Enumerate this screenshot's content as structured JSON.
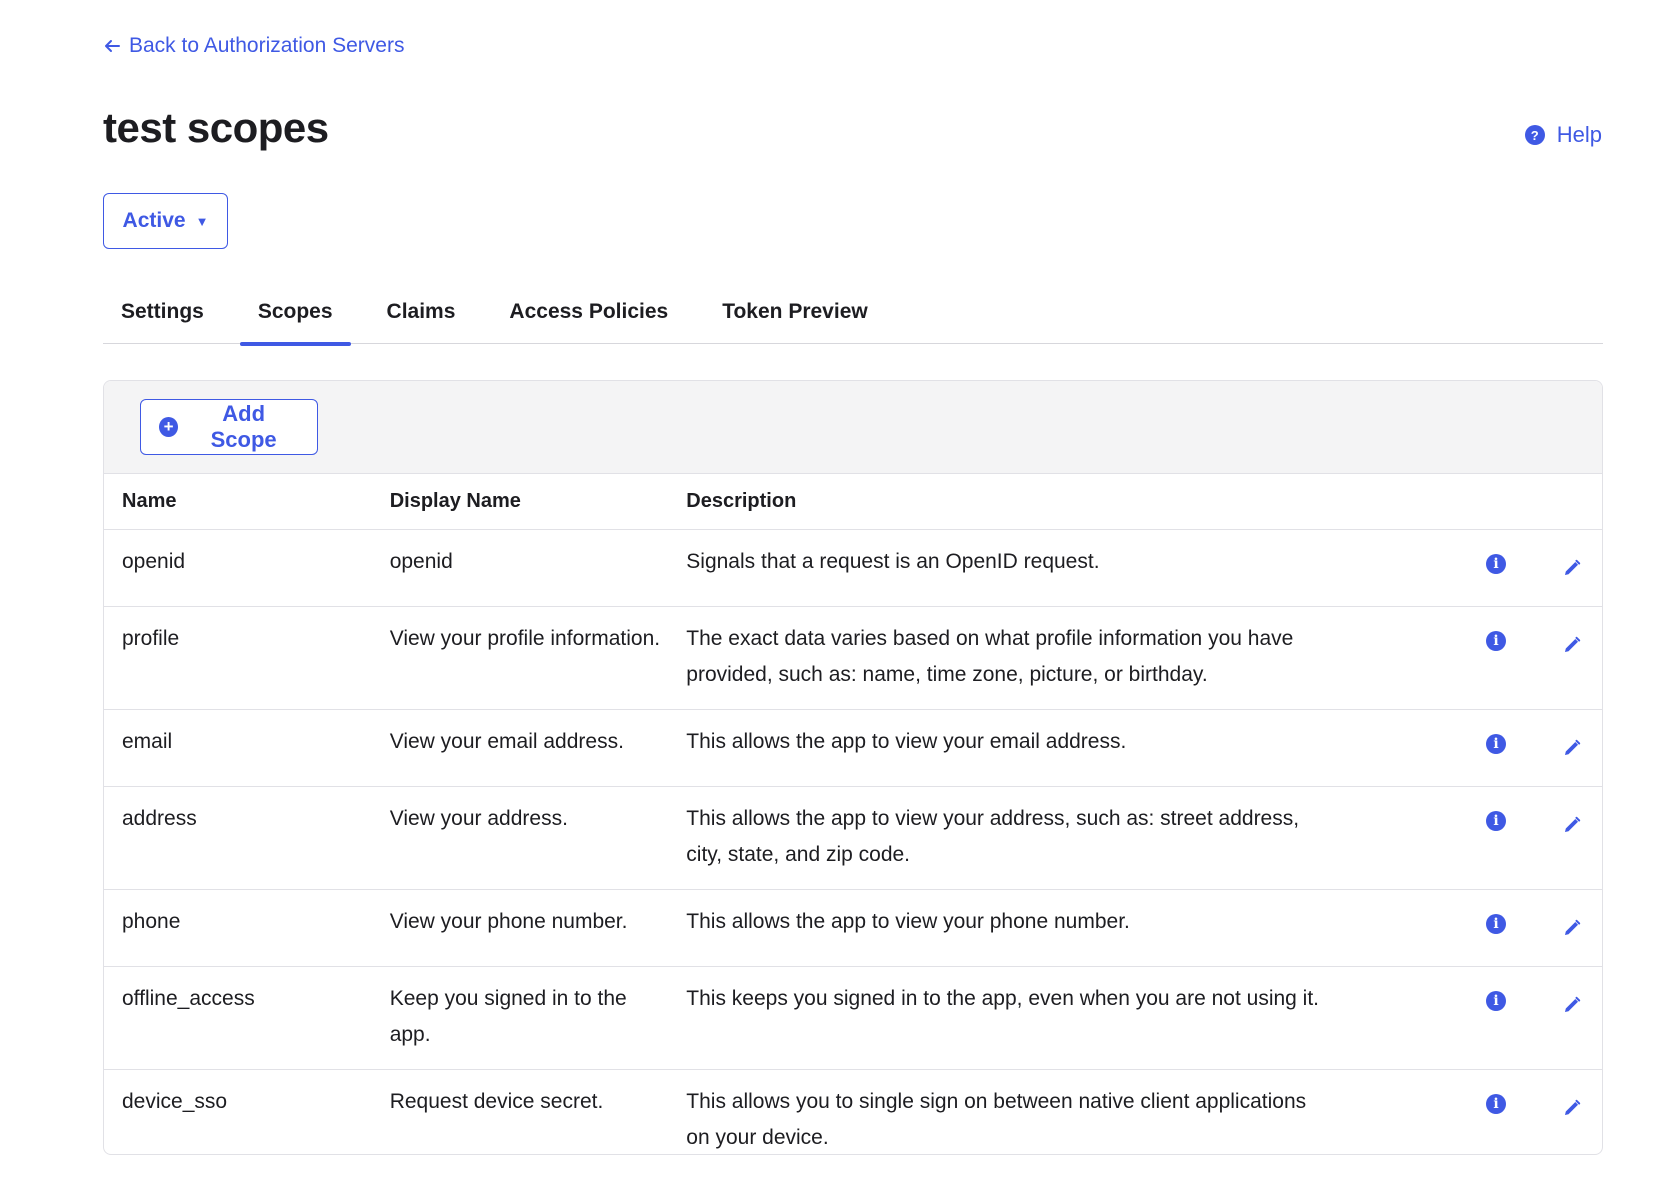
{
  "nav": {
    "back_label": "Back to Authorization Servers"
  },
  "header": {
    "title": "test scopes",
    "help_label": "Help"
  },
  "status": {
    "label": "Active"
  },
  "tabs": [
    {
      "label": "Settings",
      "active": false
    },
    {
      "label": "Scopes",
      "active": true
    },
    {
      "label": "Claims",
      "active": false
    },
    {
      "label": "Access Policies",
      "active": false
    },
    {
      "label": "Token Preview",
      "active": false
    }
  ],
  "toolbar": {
    "add_label": "Add Scope"
  },
  "table": {
    "headers": {
      "name": "Name",
      "display_name": "Display Name",
      "description": "Description"
    },
    "rows": [
      {
        "name": "openid",
        "display_name": "openid",
        "description": "Signals that a request is an OpenID request."
      },
      {
        "name": "profile",
        "display_name": "View your profile information.",
        "description": "The exact data varies based on what profile information you have provided, such as: name, time zone, picture, or birthday."
      },
      {
        "name": "email",
        "display_name": "View your email address.",
        "description": "This allows the app to view your email address."
      },
      {
        "name": "address",
        "display_name": "View your address.",
        "description": "This allows the app to view your address, such as: street address, city, state, and zip code."
      },
      {
        "name": "phone",
        "display_name": "View your phone number.",
        "description": "This allows the app to view your phone number."
      },
      {
        "name": "offline_access",
        "display_name": "Keep you signed in to the app.",
        "description": "This keeps you signed in to the app, even when you are not using it."
      },
      {
        "name": "device_sso",
        "display_name": "Request device secret.",
        "description": "This allows you to single sign on between native client applications on your device."
      }
    ]
  },
  "colors": {
    "accent": "#3f59e4",
    "text": "#1d1d21",
    "toolbar_bg": "#f4f4f5",
    "border": "#e1e1e6"
  },
  "icons": [
    "arrow-left-icon",
    "help-icon",
    "caret-down-icon",
    "plus-circle-icon",
    "info-icon",
    "pencil-icon"
  ]
}
